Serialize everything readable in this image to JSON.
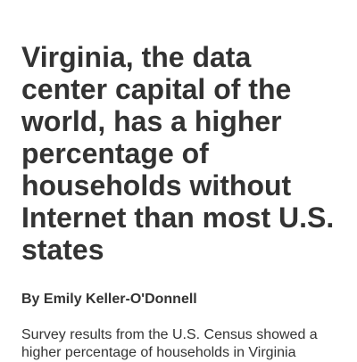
{
  "article": {
    "headline": "Virginia, the data center capital of the world, has a higher percentage of households without Internet than most U.S. states",
    "byline": "By Emily Keller-O'Donnell",
    "summary": "Survey results from the U.S. Census showed a higher percentage of households in Virginia"
  },
  "colors": {
    "text": "#333333",
    "background": "#ffffff"
  }
}
